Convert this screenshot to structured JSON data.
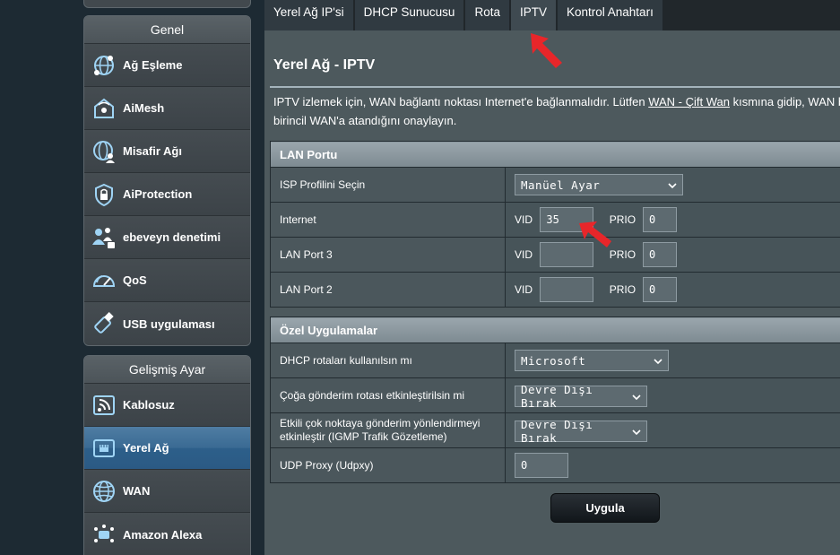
{
  "sidebar": {
    "general_header": "Genel",
    "general_items": [
      {
        "label": "Ağ Eşleme",
        "icon": "network-map-icon"
      },
      {
        "label": "AiMesh",
        "icon": "aimesh-icon"
      },
      {
        "label": "Misafir Ağı",
        "icon": "guest-network-icon"
      },
      {
        "label": "AiProtection",
        "icon": "shield-icon"
      },
      {
        "label": "ebeveyn denetimi",
        "icon": "parental-control-icon"
      },
      {
        "label": "QoS",
        "icon": "speedometer-icon"
      },
      {
        "label": "USB uygulaması",
        "icon": "usb-icon"
      }
    ],
    "advanced_header": "Gelişmiş Ayar",
    "advanced_items": [
      {
        "label": "Kablosuz",
        "icon": "wireless-icon"
      },
      {
        "label": "Yerel Ağ",
        "icon": "lan-icon",
        "active": true
      },
      {
        "label": "WAN",
        "icon": "globe-icon"
      },
      {
        "label": "Amazon Alexa",
        "icon": "alexa-icon"
      }
    ]
  },
  "tabs": [
    {
      "label": "Yerel Ağ IP'si"
    },
    {
      "label": "DHCP Sunucusu"
    },
    {
      "label": "Rota"
    },
    {
      "label": "IPTV",
      "active": true
    },
    {
      "label": "Kontrol Anahtarı"
    }
  ],
  "page": {
    "title": "Yerel Ağ - IPTV",
    "desc_part1": "IPTV izlemek için, WAN bağlantı noktası Internet'e bağlanmalıdır. Lütfen ",
    "desc_link": "WAN - Çift Wan",
    "desc_part2": " kısmına gidip, WAN b",
    "desc_line2": "birincil WAN'a atandığını onaylayın."
  },
  "lan_port": {
    "header": "LAN Portu",
    "isp_label": "ISP Profilini Seçin",
    "isp_value": "Manüel Ayar",
    "vid_label": "VID",
    "prio_label": "PRIO",
    "rows": [
      {
        "label": "Internet",
        "vid": "35",
        "prio": "0"
      },
      {
        "label": "LAN Port 3",
        "vid": "",
        "prio": "0"
      },
      {
        "label": "LAN Port 2",
        "vid": "",
        "prio": "0"
      }
    ]
  },
  "special_apps": {
    "header": "Özel Uygulamalar",
    "dhcp_label": "DHCP rotaları kullanılsın mı",
    "dhcp_value": "Microsoft",
    "multicast_label": "Çoğa gönderim rotası etkinleştirilsin mi",
    "multicast_value": "Devre Dışı Bırak",
    "igmp_label_line1": "Etkili çok noktaya gönderim yönlendirmeyi",
    "igmp_label_line2": "etkinleştir (IGMP Trafik Gözetleme)",
    "igmp_value": "Devre Dışı Bırak",
    "udp_label": "UDP Proxy (Udpxy)",
    "udp_value": "0"
  },
  "apply_label": "Uygula",
  "colors": {
    "content_bg": "#4d595d",
    "active_menu": "#2d5f8a",
    "arrow": "#e8262a"
  }
}
